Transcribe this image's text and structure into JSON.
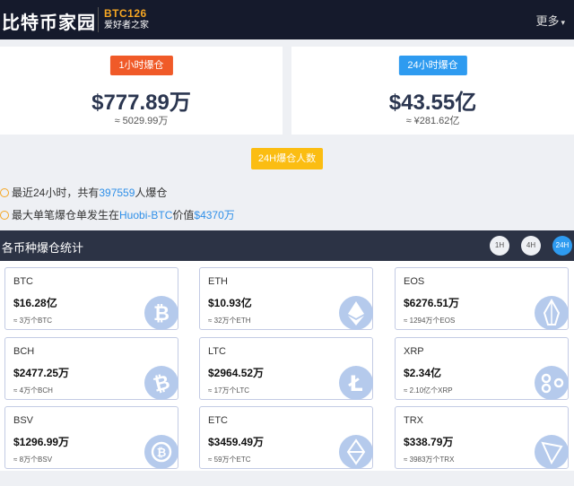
{
  "header": {
    "brand": "比特币家园",
    "logo_top": "BTC126",
    "logo_sub": "爱好者之家",
    "more": "更多"
  },
  "stats": [
    {
      "label": "1小时爆仓",
      "value": "$777.89万",
      "sub": "≈ 5029.99万",
      "color": "#f05a28"
    },
    {
      "label": "24小时爆仓",
      "value": "$43.55亿",
      "sub": "≈ ¥281.62亿",
      "color": "#2e9bf0"
    }
  ],
  "people": {
    "label": "24H爆仓人数",
    "line1_a": "最近24小时，共有",
    "line1_num": "397559",
    "line1_b": "人爆仓",
    "line2_a": "最大单笔爆仓单发生在",
    "line2_ex": "Huobi-BTC",
    "line2_b": "价值",
    "line2_val": "$4370万"
  },
  "section": {
    "title": "各币种爆仓统计",
    "buttons": [
      "1H",
      "4H",
      "24H"
    ],
    "active": "24H"
  },
  "coins": [
    {
      "name": "BTC",
      "value": "$16.28亿",
      "sub": "≈ 3万个BTC",
      "icon": "bitcoin-icon"
    },
    {
      "name": "ETH",
      "value": "$10.93亿",
      "sub": "≈ 32万个ETH",
      "icon": "ethereum-icon"
    },
    {
      "name": "EOS",
      "value": "$6276.51万",
      "sub": "≈ 1294万个EOS",
      "icon": "eos-icon"
    },
    {
      "name": "BCH",
      "value": "$2477.25万",
      "sub": "≈ 4万个BCH",
      "icon": "bitcoin-cash-icon"
    },
    {
      "name": "LTC",
      "value": "$2964.52万",
      "sub": "≈ 17万个LTC",
      "icon": "litecoin-icon"
    },
    {
      "name": "XRP",
      "value": "$2.34亿",
      "sub": "≈ 2.10亿个XRP",
      "icon": "ripple-icon"
    },
    {
      "name": "BSV",
      "value": "$1296.99万",
      "sub": "≈ 8万个BSV",
      "icon": "bitcoin-sv-icon"
    },
    {
      "name": "ETC",
      "value": "$3459.49万",
      "sub": "≈ 59万个ETC",
      "icon": "ethereum-classic-icon"
    },
    {
      "name": "TRX",
      "value": "$338.79万",
      "sub": "≈ 3983万个TRX",
      "icon": "tron-icon"
    }
  ]
}
